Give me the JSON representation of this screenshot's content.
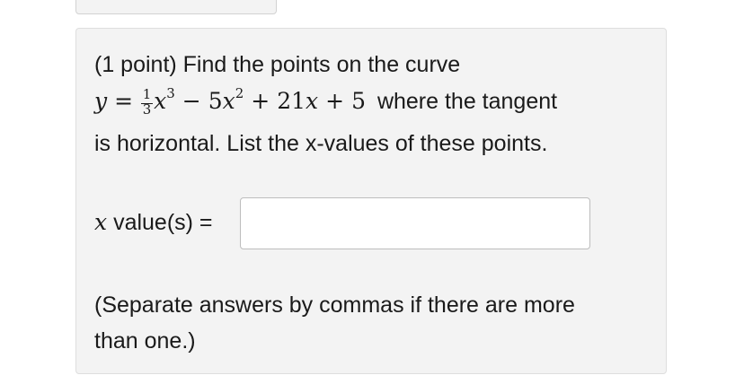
{
  "problem": {
    "intro": "(1 point) Find the points on the curve",
    "equation": {
      "lhs": "y",
      "equals": "=",
      "frac_num": "1",
      "frac_den": "3",
      "term1_var": "x",
      "term1_exp": "3",
      "op1": "−",
      "term2_coef": "5",
      "term2_var": "x",
      "term2_exp": "2",
      "op2": "+",
      "term3_coef": "21",
      "term3_var": "x",
      "op3": "+",
      "term4": "5"
    },
    "line2_tail": "where the tangent",
    "line3": "is horizontal. List the x-values of these points.",
    "answer_var": "x",
    "answer_label": "value(s) =",
    "answer_value": "",
    "note_line1": "(Separate answers by commas if there are more",
    "note_line2": "than one.)"
  }
}
